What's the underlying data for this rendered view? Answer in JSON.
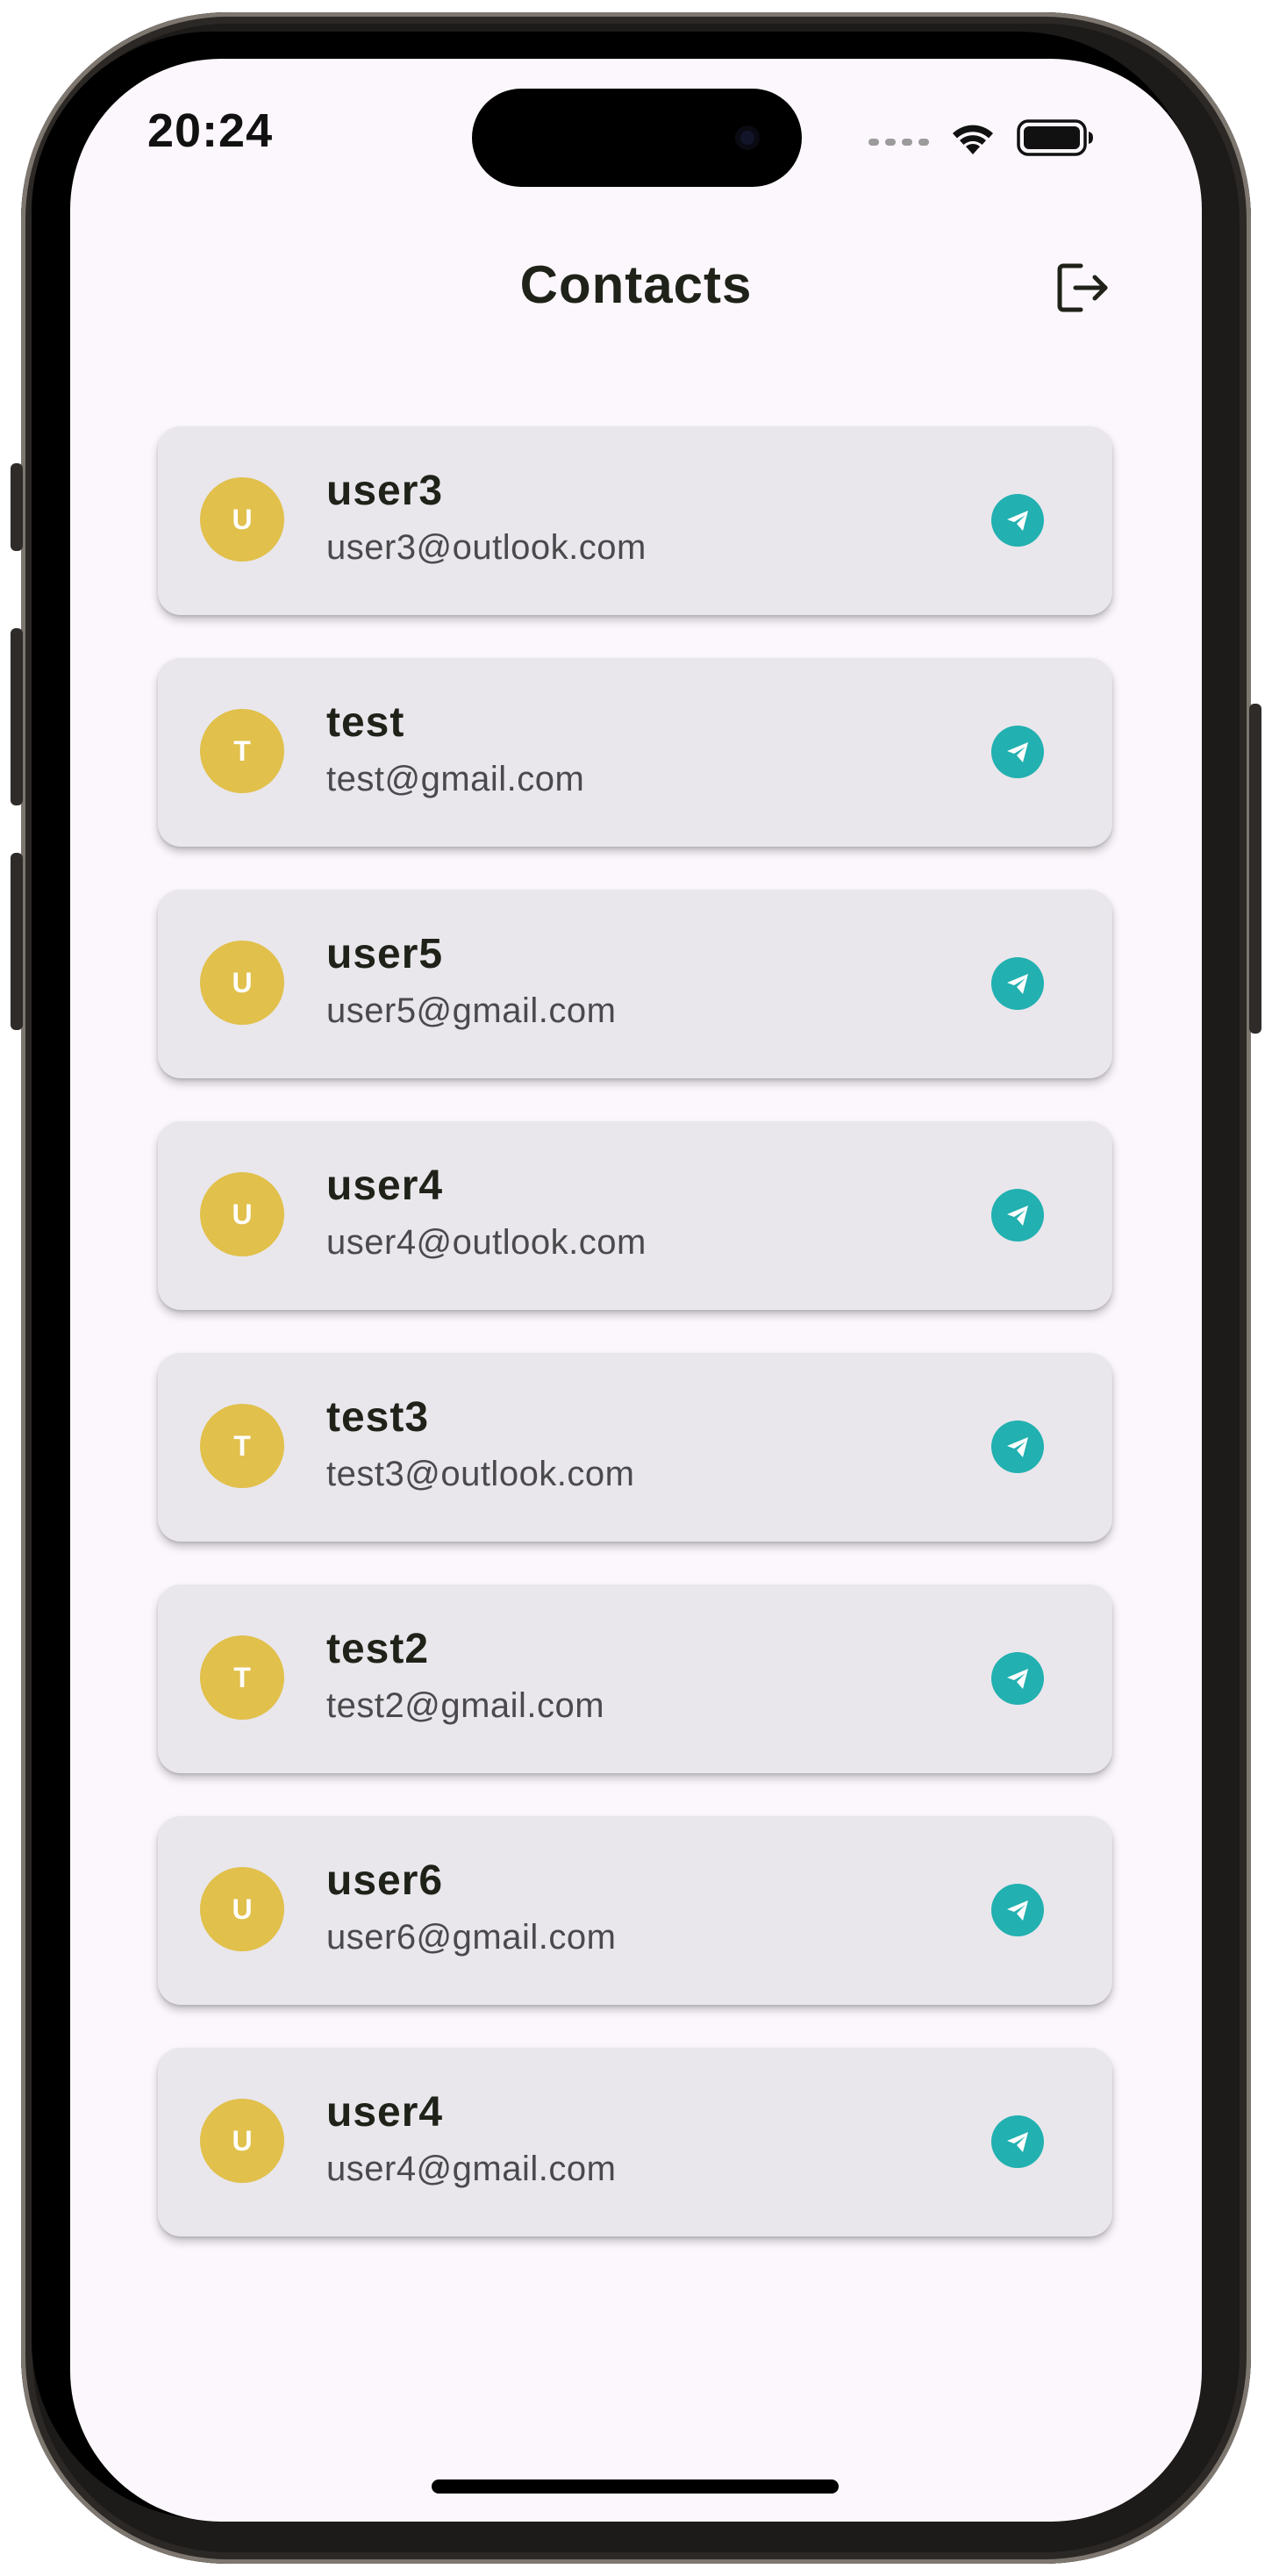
{
  "status_bar": {
    "time": "20:24",
    "icons": [
      "cellular-signal-icon",
      "wifi-icon",
      "battery-icon"
    ]
  },
  "header": {
    "title": "Contacts",
    "logout_icon": "logout-icon"
  },
  "colors": {
    "background": "#fcf7fc",
    "card": "#e9e7ec",
    "avatar": "#e1c04b",
    "send_button": "#22b0b0",
    "title_text": "#1f2218",
    "email_text": "#4a4a4c"
  },
  "contacts": [
    {
      "initial": "U",
      "name": "user3",
      "email": "user3@outlook.com"
    },
    {
      "initial": "T",
      "name": "test",
      "email": "test@gmail.com"
    },
    {
      "initial": "U",
      "name": "user5",
      "email": "user5@gmail.com"
    },
    {
      "initial": "U",
      "name": "user4",
      "email": "user4@outlook.com"
    },
    {
      "initial": "T",
      "name": "test3",
      "email": "test3@outlook.com"
    },
    {
      "initial": "T",
      "name": "test2",
      "email": "test2@gmail.com"
    },
    {
      "initial": "U",
      "name": "user6",
      "email": "user6@gmail.com"
    },
    {
      "initial": "U",
      "name": "user4",
      "email": "user4@gmail.com"
    }
  ]
}
